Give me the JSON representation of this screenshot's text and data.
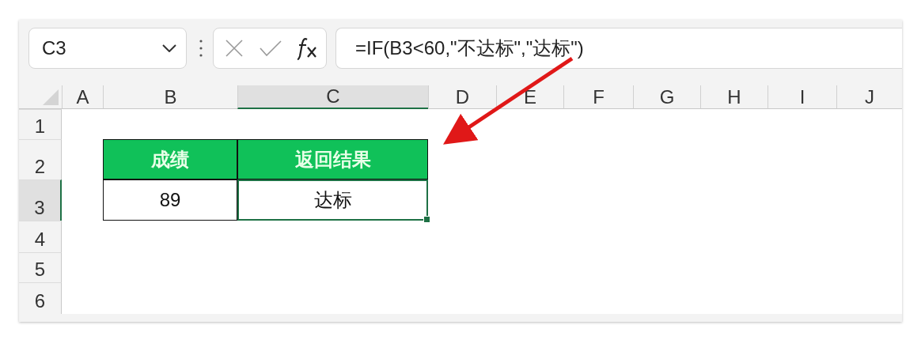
{
  "name_box": {
    "value": "C3"
  },
  "formula_bar": {
    "value": "=IF(B3<60,\"不达标\",\"达标\")"
  },
  "columns": [
    {
      "label": "A",
      "selected": false
    },
    {
      "label": "B",
      "selected": false
    },
    {
      "label": "C",
      "selected": true
    },
    {
      "label": "D",
      "selected": false
    },
    {
      "label": "E",
      "selected": false
    },
    {
      "label": "F",
      "selected": false
    },
    {
      "label": "G",
      "selected": false
    },
    {
      "label": "H",
      "selected": false
    },
    {
      "label": "I",
      "selected": false
    },
    {
      "label": "J",
      "selected": false
    }
  ],
  "rows": [
    {
      "label": "1",
      "selected": false
    },
    {
      "label": "2",
      "selected": false
    },
    {
      "label": "3",
      "selected": true
    },
    {
      "label": "4",
      "selected": false
    },
    {
      "label": "5",
      "selected": false
    },
    {
      "label": "6",
      "selected": false
    }
  ],
  "table": {
    "header": [
      "成绩",
      "返回结果"
    ],
    "rows": [
      [
        {
          "text": "89",
          "selected": false
        },
        {
          "text": "达标",
          "selected": true
        }
      ]
    ]
  }
}
